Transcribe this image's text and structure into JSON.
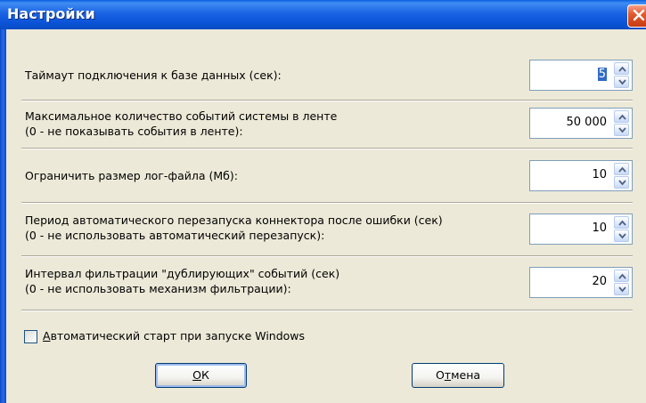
{
  "window": {
    "title": "Настройки"
  },
  "settings": [
    {
      "label_lines": [
        "Таймаут подключения к базе данных (сек):"
      ],
      "value": "5",
      "selected": true
    },
    {
      "label_lines": [
        "Максимальное количество событий системы в ленте",
        "(0 - не показывать события в ленте):"
      ],
      "value": "50 000",
      "selected": false
    },
    {
      "label_lines": [
        "Ограничить размер лог-файла (Мб):"
      ],
      "value": "10",
      "selected": false
    },
    {
      "label_lines": [
        "Период автоматического перезапуска коннектора после ошибки (сек)",
        "(0 - не использовать автоматический перезапуск):"
      ],
      "value": "10",
      "selected": false
    },
    {
      "label_lines": [
        "Интервал фильтрации \"дублирующих\" событий (сек)",
        "(0 - не использовать механизм фильтрации):"
      ],
      "value": "20",
      "selected": false
    }
  ],
  "autostart": {
    "label_mnemonic": "А",
    "label_rest": "втоматический старт при запуске Windows",
    "checked": false
  },
  "buttons": {
    "ok_mnemonic": "О",
    "ok_rest": "К",
    "cancel_pre": "О",
    "cancel_mnemonic": "т",
    "cancel_rest": "мена"
  },
  "colors": {
    "titlebar": "#0A53D6",
    "dialog_bg": "#ECE9D8",
    "selection": "#316AC5"
  }
}
